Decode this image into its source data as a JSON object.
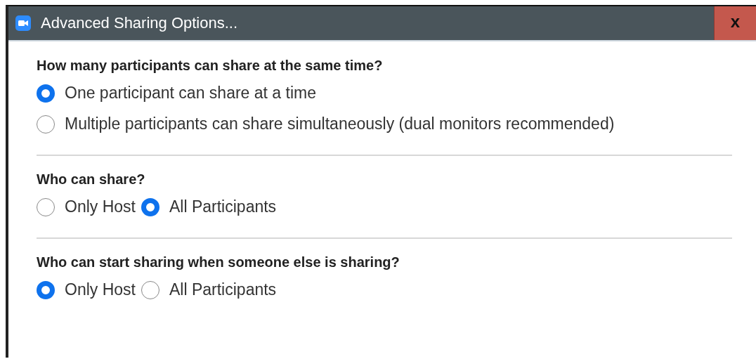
{
  "window": {
    "title": "Advanced Sharing Options...",
    "close": "x"
  },
  "sections": [
    {
      "heading": "How many participants can share at the same time?",
      "kind": "stacked",
      "options": [
        {
          "label": "One participant can share at a time",
          "selected": true
        },
        {
          "label": "Multiple participants can share simultaneously (dual monitors recommended)",
          "selected": false
        }
      ]
    },
    {
      "heading": "Who can share?",
      "kind": "inline",
      "options": [
        {
          "label": "Only Host",
          "selected": false
        },
        {
          "label": "All Participants",
          "selected": true
        }
      ]
    },
    {
      "heading": "Who can start sharing when someone else is sharing?",
      "kind": "inline",
      "options": [
        {
          "label": "Only Host",
          "selected": true
        },
        {
          "label": "All Participants",
          "selected": false
        }
      ]
    }
  ]
}
